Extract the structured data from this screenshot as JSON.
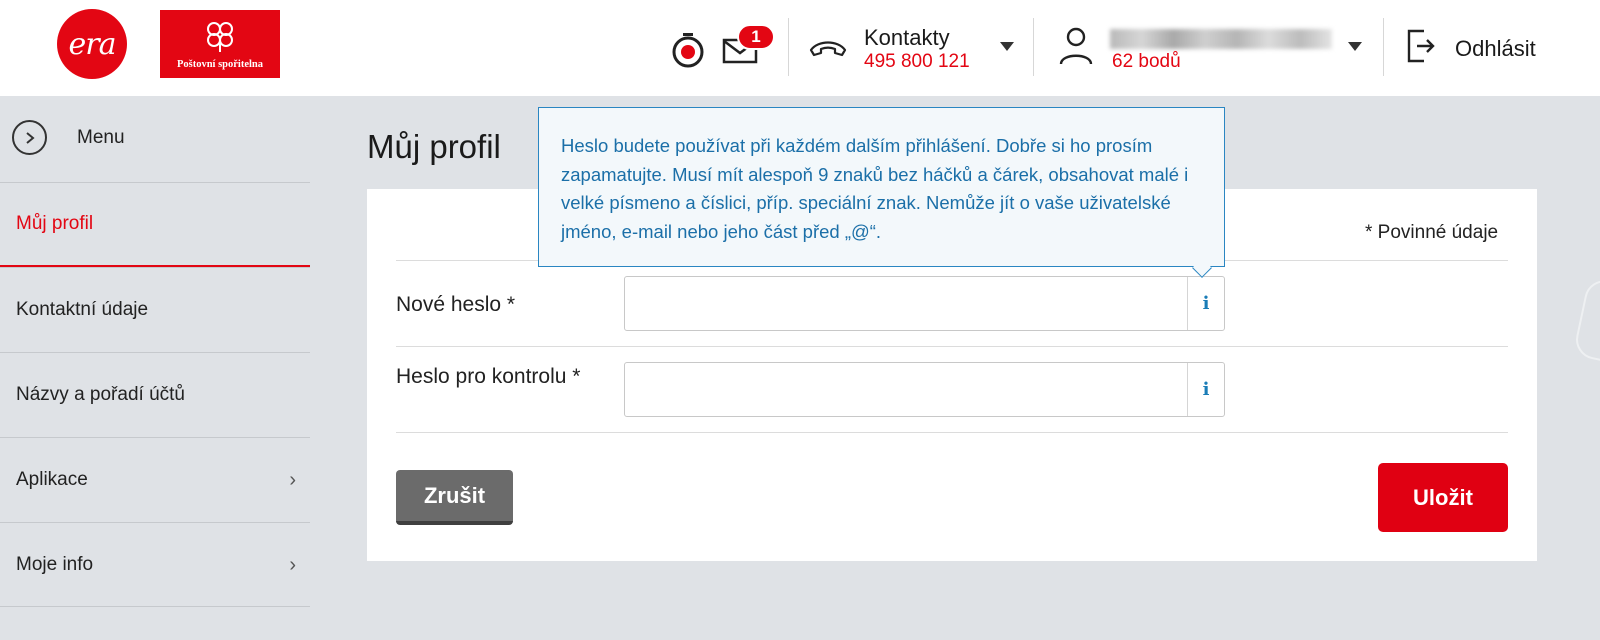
{
  "header": {
    "logo_era_text": "era",
    "logo_ps_text": "Poštovní spořitelna",
    "mail_badge": "1",
    "contact": {
      "title": "Kontakty",
      "phone": "495 800 121"
    },
    "user": {
      "points": "62 bodů"
    },
    "logout_label": "Odhlásit"
  },
  "sidebar": {
    "menu_label": "Menu",
    "items": [
      {
        "label": "Můj profil"
      },
      {
        "label": "Kontaktní údaje"
      },
      {
        "label": "Názvy a pořadí účtů"
      },
      {
        "label": "Aplikace"
      },
      {
        "label": "Moje info"
      }
    ]
  },
  "main": {
    "title": "Můj profil",
    "required_note": "* Povinné údaje",
    "fields": [
      {
        "label": "Nové heslo *",
        "value": "",
        "info": "i"
      },
      {
        "label": "Heslo pro kontrolu *",
        "value": "",
        "info": "i"
      }
    ],
    "cancel_label": "Zrušit",
    "save_label": "Uložit"
  },
  "tooltip": {
    "text": "Heslo budete používat při každém dalším přihlášení. Dobře si ho prosím zapamatujte. Musí mít alespoň 9 znaků bez háčků a čárek, obsahovat malé i velké písmeno a číslici, příp. speciální znak. Nemůže jít o vaše uživatelské jméno, e-mail nebo jeho část před „@“."
  },
  "colors": {
    "brand_red": "#e30613",
    "info_blue": "#1b7db7",
    "page_bg": "#dfe2e6"
  }
}
